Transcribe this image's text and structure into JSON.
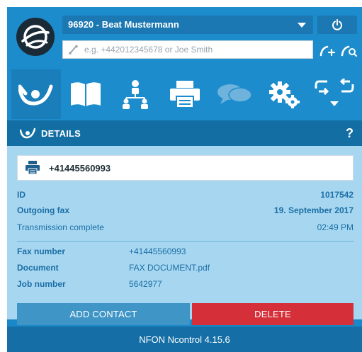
{
  "header": {
    "user_label": "96920 - Beat Mustermann",
    "search_placeholder": "e.g. +442012345678 or Joe Smith"
  },
  "toolbar": {
    "items": [
      "fax",
      "phonebook",
      "contacts",
      "printer",
      "chat",
      "settings",
      "transfer"
    ],
    "active": "fax"
  },
  "details": {
    "title": "DETAILS",
    "help": "?",
    "fax_number_display": "+41445560993",
    "id_label": "ID",
    "id_value": "1017542",
    "type_label": "Outgoing fax",
    "date": "19. September 2017",
    "status": "Transmission complete",
    "time": "02:49 PM",
    "fields": [
      {
        "label": "Fax number",
        "value": "+41445560993"
      },
      {
        "label": "Document",
        "value": "FAX DOCUMENT.pdf"
      },
      {
        "label": "Job number",
        "value": "5642977"
      }
    ]
  },
  "actions": {
    "add_contact": "ADD CONTACT",
    "delete": "DELETE"
  },
  "footer": {
    "version": "NFON Ncontrol 4.15.6"
  },
  "colors": {
    "primary": "#1c8ccc",
    "dark": "#126ea3",
    "panel": "#a7d7f0",
    "danger": "#d5303a"
  }
}
